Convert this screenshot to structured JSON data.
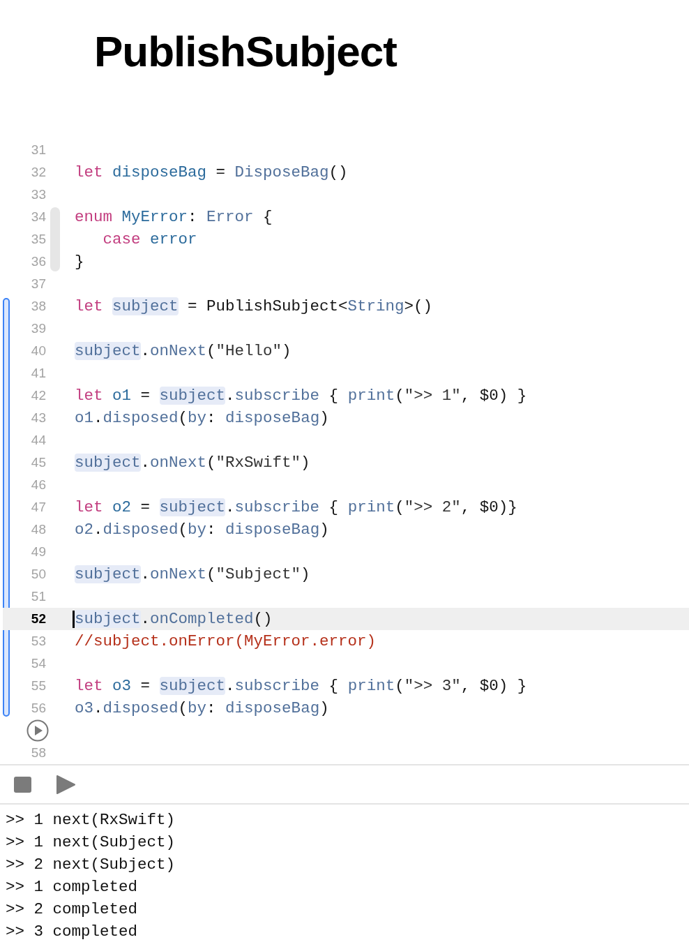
{
  "title": "PublishSubject",
  "code": {
    "groups": [
      {
        "kind": "plain",
        "lines": [
          {
            "kind": "code",
            "number": "31"
          },
          {
            "kind": "code",
            "number": "32",
            "tokens": [
              {
                "kind": "keyword",
                "text": "let "
              },
              {
                "kind": "declaration",
                "text": "disposeBag"
              },
              {
                "kind": "plain",
                "text": " = "
              },
              {
                "kind": "reference",
                "text": "DisposeBag"
              },
              {
                "kind": "plain",
                "text": "()"
              }
            ]
          },
          {
            "kind": "code",
            "number": "33"
          }
        ]
      },
      {
        "kind": "folded",
        "lines": [
          {
            "kind": "code",
            "number": "34",
            "tokens": [
              {
                "kind": "keyword",
                "text": "enum "
              },
              {
                "kind": "declaration",
                "text": "MyError"
              },
              {
                "kind": "plain",
                "text": ": "
              },
              {
                "kind": "reference",
                "text": "Error"
              },
              {
                "kind": "plain",
                "text": " {"
              }
            ]
          },
          {
            "kind": "code",
            "number": "35",
            "tokens": [
              {
                "kind": "keyword",
                "text": "   case "
              },
              {
                "kind": "declaration",
                "text": "error"
              }
            ]
          },
          {
            "kind": "code",
            "number": "36",
            "tokens": [
              {
                "kind": "plain",
                "text": "}"
              }
            ]
          }
        ]
      },
      {
        "kind": "plain",
        "lines": [
          {
            "kind": "code",
            "number": "37"
          }
        ]
      },
      {
        "kind": "changed",
        "lines": [
          {
            "kind": "code",
            "number": "38",
            "tokens": [
              {
                "kind": "keyword",
                "text": "let "
              },
              {
                "kind": "match",
                "text": "subject"
              },
              {
                "kind": "plain",
                "text": " = PublishSubject<"
              },
              {
                "kind": "reference",
                "text": "String"
              },
              {
                "kind": "plain",
                "text": ">()"
              }
            ]
          },
          {
            "kind": "code",
            "number": "39"
          },
          {
            "kind": "code",
            "number": "40",
            "tokens": [
              {
                "kind": "match",
                "text": "subject"
              },
              {
                "kind": "plain",
                "text": "."
              },
              {
                "kind": "reference",
                "text": "onNext"
              },
              {
                "kind": "plain",
                "text": "("
              },
              {
                "kind": "string",
                "text": "\"Hello\""
              },
              {
                "kind": "plain",
                "text": ")"
              }
            ]
          },
          {
            "kind": "code",
            "number": "41"
          },
          {
            "kind": "code",
            "number": "42",
            "tokens": [
              {
                "kind": "keyword",
                "text": "let "
              },
              {
                "kind": "declaration",
                "text": "o1"
              },
              {
                "kind": "plain",
                "text": " = "
              },
              {
                "kind": "match",
                "text": "subject"
              },
              {
                "kind": "plain",
                "text": "."
              },
              {
                "kind": "reference",
                "text": "subscribe"
              },
              {
                "kind": "plain",
                "text": " { "
              },
              {
                "kind": "reference",
                "text": "print"
              },
              {
                "kind": "plain",
                "text": "("
              },
              {
                "kind": "string",
                "text": "\">> 1\""
              },
              {
                "kind": "plain",
                "text": ", $0) }"
              }
            ]
          },
          {
            "kind": "code",
            "number": "43",
            "tokens": [
              {
                "kind": "reference",
                "text": "o1"
              },
              {
                "kind": "plain",
                "text": "."
              },
              {
                "kind": "reference",
                "text": "disposed"
              },
              {
                "kind": "plain",
                "text": "("
              },
              {
                "kind": "reference",
                "text": "by"
              },
              {
                "kind": "plain",
                "text": ": "
              },
              {
                "kind": "reference",
                "text": "disposeBag"
              },
              {
                "kind": "plain",
                "text": ")"
              }
            ]
          },
          {
            "kind": "code",
            "number": "44"
          },
          {
            "kind": "code",
            "number": "45",
            "tokens": [
              {
                "kind": "match",
                "text": "subject"
              },
              {
                "kind": "plain",
                "text": "."
              },
              {
                "kind": "reference",
                "text": "onNext"
              },
              {
                "kind": "plain",
                "text": "("
              },
              {
                "kind": "string",
                "text": "\"RxSwift\""
              },
              {
                "kind": "plain",
                "text": ")"
              }
            ]
          },
          {
            "kind": "code",
            "number": "46"
          },
          {
            "kind": "code",
            "number": "47",
            "tokens": [
              {
                "kind": "keyword",
                "text": "let "
              },
              {
                "kind": "declaration",
                "text": "o2"
              },
              {
                "kind": "plain",
                "text": " = "
              },
              {
                "kind": "match",
                "text": "subject"
              },
              {
                "kind": "plain",
                "text": "."
              },
              {
                "kind": "reference",
                "text": "subscribe"
              },
              {
                "kind": "plain",
                "text": " { "
              },
              {
                "kind": "reference",
                "text": "print"
              },
              {
                "kind": "plain",
                "text": "("
              },
              {
                "kind": "string",
                "text": "\">> 2\""
              },
              {
                "kind": "plain",
                "text": ", $0)}"
              }
            ]
          },
          {
            "kind": "code",
            "number": "48",
            "tokens": [
              {
                "kind": "reference",
                "text": "o2"
              },
              {
                "kind": "plain",
                "text": "."
              },
              {
                "kind": "reference",
                "text": "disposed"
              },
              {
                "kind": "plain",
                "text": "("
              },
              {
                "kind": "reference",
                "text": "by"
              },
              {
                "kind": "plain",
                "text": ": "
              },
              {
                "kind": "reference",
                "text": "disposeBag"
              },
              {
                "kind": "plain",
                "text": ")"
              }
            ]
          },
          {
            "kind": "code",
            "number": "49"
          },
          {
            "kind": "code",
            "number": "50",
            "tokens": [
              {
                "kind": "match",
                "text": "subject"
              },
              {
                "kind": "plain",
                "text": "."
              },
              {
                "kind": "reference",
                "text": "onNext"
              },
              {
                "kind": "plain",
                "text": "("
              },
              {
                "kind": "string",
                "text": "\"Subject\""
              },
              {
                "kind": "plain",
                "text": ")"
              }
            ]
          },
          {
            "kind": "code",
            "number": "51"
          },
          {
            "kind": "current",
            "number": "52",
            "tokens": [
              {
                "kind": "match",
                "text": "subject"
              },
              {
                "kind": "plain",
                "text": "."
              },
              {
                "kind": "reference",
                "text": "onCompleted"
              },
              {
                "kind": "plain",
                "text": "()"
              }
            ]
          },
          {
            "kind": "code",
            "number": "53",
            "tokens": [
              {
                "kind": "comment",
                "text": "//subject.onError(MyError.error)"
              }
            ]
          },
          {
            "kind": "code",
            "number": "54"
          },
          {
            "kind": "code",
            "number": "55",
            "tokens": [
              {
                "kind": "keyword",
                "text": "let "
              },
              {
                "kind": "declaration",
                "text": "o3"
              },
              {
                "kind": "plain",
                "text": " = "
              },
              {
                "kind": "match",
                "text": "subject"
              },
              {
                "kind": "plain",
                "text": "."
              },
              {
                "kind": "reference",
                "text": "subscribe"
              },
              {
                "kind": "plain",
                "text": " { "
              },
              {
                "kind": "reference",
                "text": "print"
              },
              {
                "kind": "plain",
                "text": "("
              },
              {
                "kind": "string",
                "text": "\">> 3\""
              },
              {
                "kind": "plain",
                "text": ", $0) }"
              }
            ]
          },
          {
            "kind": "code",
            "number": "56",
            "tokens": [
              {
                "kind": "reference",
                "text": "o3"
              },
              {
                "kind": "plain",
                "text": "."
              },
              {
                "kind": "reference",
                "text": "disposed"
              },
              {
                "kind": "plain",
                "text": "("
              },
              {
                "kind": "reference",
                "text": "by"
              },
              {
                "kind": "plain",
                "text": ": "
              },
              {
                "kind": "reference",
                "text": "disposeBag"
              },
              {
                "kind": "plain",
                "text": ")"
              }
            ]
          }
        ]
      },
      {
        "kind": "plain",
        "lines": [
          {
            "kind": "run"
          },
          {
            "kind": "code",
            "number": "58"
          }
        ]
      }
    ]
  },
  "console": {
    "output": [
      ">> 1 next(RxSwift)",
      ">> 1 next(Subject)",
      ">> 2 next(Subject)",
      ">> 1 completed",
      ">> 2 completed",
      ">> 3 completed"
    ]
  }
}
